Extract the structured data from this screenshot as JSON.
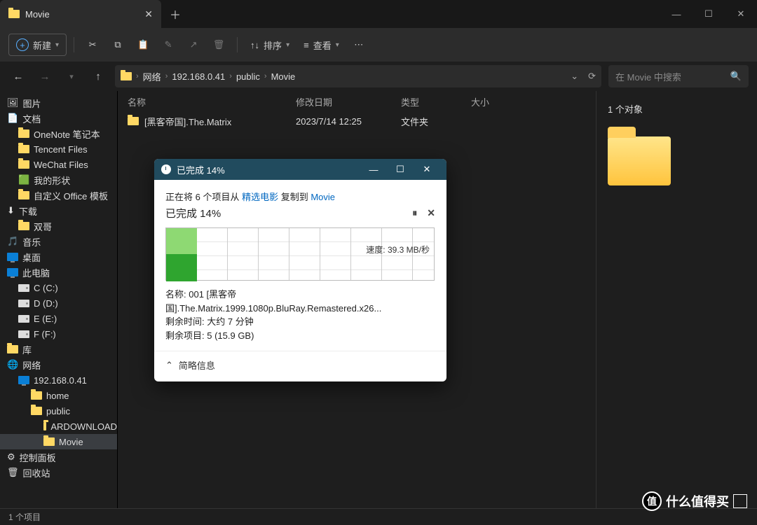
{
  "tab_title": "Movie",
  "toolbar": {
    "new": "新建",
    "sort": "排序",
    "view": "查看"
  },
  "nav": {
    "back": "←",
    "fwd": "→",
    "up": "↑"
  },
  "breadcrumb": [
    "网络",
    "192.168.0.41",
    "public",
    "Movie"
  ],
  "search_placeholder": "在 Movie 中搜索",
  "columns": {
    "name": "名称",
    "date": "修改日期",
    "type": "类型",
    "size": "大小"
  },
  "files": [
    {
      "name": "[黑客帝国].The.Matrix",
      "date": "2023/7/14 12:25",
      "type": "文件夹"
    }
  ],
  "detail": {
    "count": "1 个对象"
  },
  "tree": [
    {
      "label": "图片",
      "icon": "pic"
    },
    {
      "label": "文档",
      "icon": "doc"
    },
    {
      "label": "OneNote 笔记本",
      "icon": "fold-y",
      "lvl": 1
    },
    {
      "label": "Tencent Files",
      "icon": "fold-y",
      "lvl": 1
    },
    {
      "label": "WeChat Files",
      "icon": "fold-y",
      "lvl": 1
    },
    {
      "label": "我的形状",
      "icon": "shape",
      "lvl": 1
    },
    {
      "label": "自定义 Office 模板",
      "icon": "fold-y",
      "lvl": 1
    },
    {
      "label": "下载",
      "icon": "dl"
    },
    {
      "label": "双哥",
      "icon": "fold-y",
      "lvl": 1
    },
    {
      "label": "音乐",
      "icon": "music"
    },
    {
      "label": "桌面",
      "icon": "desk"
    },
    {
      "label": "此电脑",
      "icon": "pc"
    },
    {
      "label": "C (C:)",
      "icon": "drive",
      "lvl": 1
    },
    {
      "label": "D (D:)",
      "icon": "drive",
      "lvl": 1
    },
    {
      "label": "E (E:)",
      "icon": "drive",
      "lvl": 1
    },
    {
      "label": "F (F:)",
      "icon": "drive",
      "lvl": 1
    },
    {
      "label": "库",
      "icon": "fold-y"
    },
    {
      "label": "网络",
      "icon": "net"
    },
    {
      "label": "192.168.0.41",
      "icon": "pcnet",
      "lvl": 1
    },
    {
      "label": "home",
      "icon": "fold-y",
      "lvl": 2
    },
    {
      "label": "public",
      "icon": "fold-y",
      "lvl": 2
    },
    {
      "label": "ARDOWNLOAD",
      "icon": "fold-y",
      "lvl": 3
    },
    {
      "label": "Movie",
      "icon": "fold-y",
      "lvl": 3,
      "sel": true
    },
    {
      "label": "控制面板",
      "icon": "cp"
    },
    {
      "label": "回收站",
      "icon": "bin"
    }
  ],
  "status": "1 个项目",
  "dlg": {
    "title": "已完成 14%",
    "copying_prefix": "正在将 6 个项目从 ",
    "src": "精选电影",
    "copying_mid": " 复制到 ",
    "dst": "Movie",
    "progress": "已完成 14%",
    "pause": "⏸",
    "cancel": "✕",
    "speed_label": "速度: ",
    "speed": "39.3 MB/秒",
    "name_label": "名称: ",
    "name": "001 [黑客帝国].The.Matrix.1999.1080p.BluRay.Remastered.x26...",
    "remain_time_label": "剩余时间: ",
    "remain_time": "大约 7 分钟",
    "remain_items_label": "剩余项目: ",
    "remain_items": "5 (15.9 GB)",
    "collapse": "简略信息",
    "min": "—",
    "max": "☐",
    "close": "✕"
  },
  "watermark": "什么值得买"
}
